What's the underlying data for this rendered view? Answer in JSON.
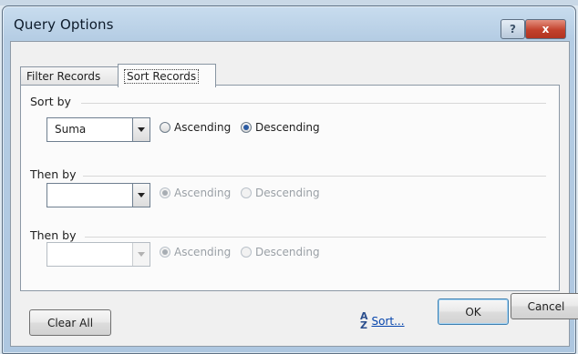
{
  "window": {
    "title": "Query Options",
    "help_label": "?",
    "close_label": "x"
  },
  "tabs": [
    {
      "label": "Filter Records"
    },
    {
      "label": "Sort Records"
    }
  ],
  "sort_by": {
    "label": "Sort by",
    "value": "Suma",
    "ascending_label": "Ascending",
    "descending_label": "Descending",
    "selected": "Descending"
  },
  "then_by_1": {
    "label": "Then by",
    "value": "",
    "ascending_label": "Ascending",
    "descending_label": "Descending",
    "selected": "Ascending"
  },
  "then_by_2": {
    "label": "Then by",
    "value": "",
    "ascending_label": "Ascending",
    "descending_label": "Descending",
    "selected": "Ascending"
  },
  "buttons": {
    "clear_all": "Clear All",
    "sort_link": "Sort...",
    "ok": "OK",
    "cancel": "Cancel"
  },
  "icons": {
    "sort": "sort-az-icon"
  }
}
